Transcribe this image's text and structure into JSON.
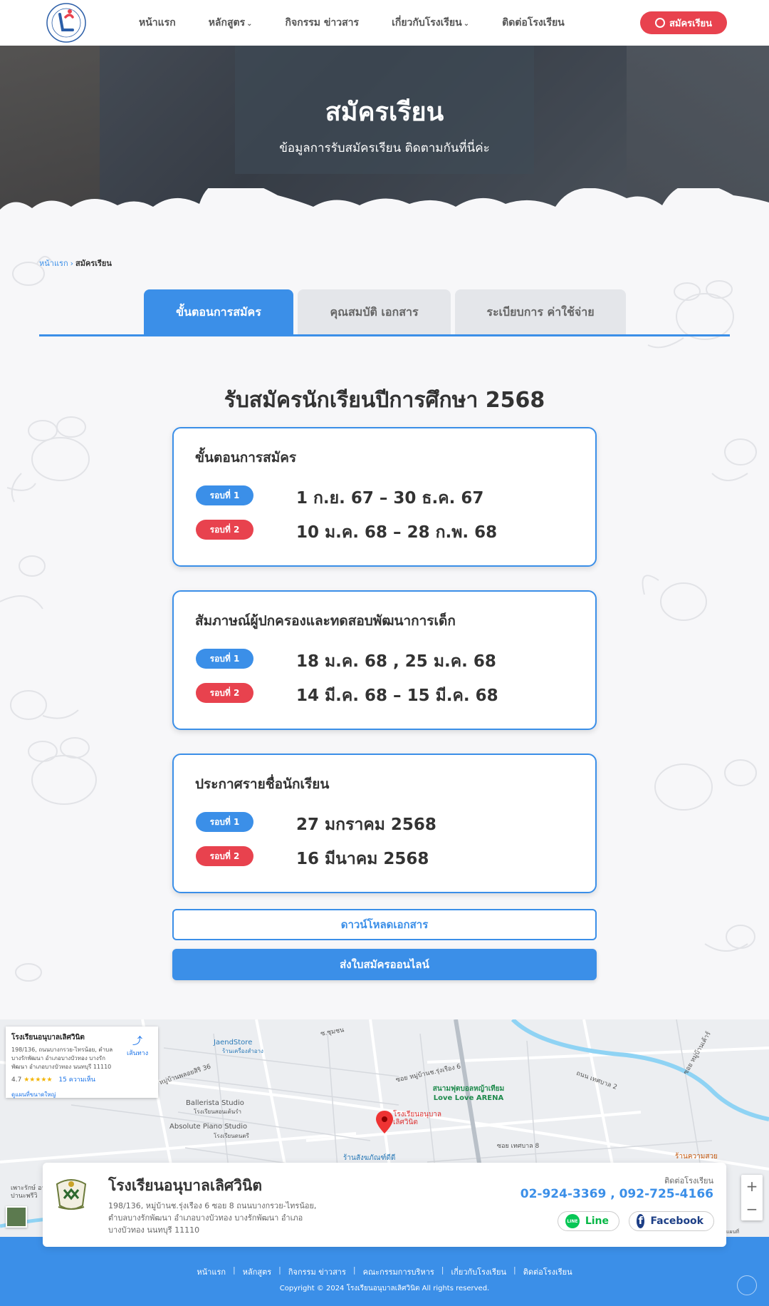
{
  "nav": {
    "links": [
      {
        "label": "หน้าแรก",
        "dropdown": false
      },
      {
        "label": "หลักสูตร",
        "dropdown": true
      },
      {
        "label": "กิจกรรม ข่าวสาร",
        "dropdown": false
      },
      {
        "label": "เกี่ยวกับโรงเรียน",
        "dropdown": true
      },
      {
        "label": "ติดต่อโรงเรียน",
        "dropdown": false
      }
    ],
    "apply_label": "สมัครเรียน"
  },
  "hero": {
    "title": "สมัครเรียน",
    "subtitle": "ข้อมูลการรับสมัครเรียน ติดตามกันที่นี่ค่ะ"
  },
  "breadcrumb": {
    "home": "หน้าแรก",
    "separator": "›",
    "current": "สมัครเรียน"
  },
  "tabs": [
    {
      "label": "ขั้นตอนการสมัคร",
      "active": true
    },
    {
      "label": "คุณสมบัติ เอกสาร",
      "active": false
    },
    {
      "label": "ระเบียบการ ค่าใช้จ่าย",
      "active": false
    }
  ],
  "section_title": "รับสมัครนักเรียนปีการศึกษา 2568",
  "cards": [
    {
      "title": "ขั้นตอนการสมัคร",
      "rounds": [
        {
          "badge": "รอบที่ 1",
          "date": "1 ก.ย. 67 – 30 ธ.ค. 67"
        },
        {
          "badge": "รอบที่ 2",
          "date": "10 ม.ค. 68 – 28 ก.พ. 68"
        }
      ]
    },
    {
      "title": "สัมภาษณ์ผู้ปกครองและทดสอบพัฒนาการเด็ก",
      "rounds": [
        {
          "badge": "รอบที่ 1",
          "date": "18 ม.ค. 68 , 25 ม.ค. 68"
        },
        {
          "badge": "รอบที่ 2",
          "date": "14 มี.ค. 68  – 15 มี.ค. 68"
        }
      ]
    },
    {
      "title": "ประกาศรายชื่อนักเรียน",
      "rounds": [
        {
          "badge": "รอบที่ 1",
          "date": "27 มกราคม 2568"
        },
        {
          "badge": "รอบที่ 2",
          "date": "16 มีนาคม 2568"
        }
      ]
    }
  ],
  "buttons": {
    "download": "ดาวน์โหลดเอกสาร",
    "submit": "ส่งใบสมัครออนไลน์"
  },
  "map": {
    "info": {
      "name": "โรงเรียนอนุบาลเลิศวินิต",
      "address": "198/136, ถนนบางกรวย-ไทรน้อย, ตำบลบางรักพัฒนา อำเภอบางบัวทอง บางรักพัฒนา อำเภอบางบัวทอง นนทบุรี 11110",
      "rating": "4.7",
      "stars": "★★★★★",
      "reviews": "15 ความเห็น",
      "larger_map": "ดูแผนที่ขนาดใหญ่",
      "directions": "เส้นทาง"
    },
    "labels": {
      "jaend": "JaendStore",
      "jaend_sub": "ร้านเครื่องสำอาง",
      "ballerista": "Ballerista Studio",
      "ballerista_sub": "โรงเรียนสอนเต้นรำ",
      "absolute": "Absolute Piano Studio",
      "absolute_sub": "โรงเรียนดนตรี",
      "arena": "สนามฟุตบอลหญ้าเทียม Love Love ARENA",
      "school_pin": "โรงเรียนอนุบาล เลิศวินิต",
      "shop": "ร้านสังฆภัณฑ์ดีดี",
      "soi1": "ซอย หมู่บ้านช.รุ่งเรือง 6",
      "soi2": "ซอย เทศบาล 8",
      "road1": "ถนน เทศบาล 2",
      "road2": "หมู่บ้านพลอยสิริ 36",
      "beauty": "ร้านความสวย",
      "village": "ซอย หมู่บ้านเค้าร์",
      "route": "ซ.ชุมชน",
      "edge": "เพาะรักษ์ อาปานะพรีวิ",
      "credit": "แผนที่"
    },
    "zoom_in": "+",
    "zoom_out": "−"
  },
  "contact": {
    "name": "โรงเรียนอนุบาลเลิศวินิต",
    "address": "198/136, หมู่บ้านช.รุ่งเรือง 6 ซอย 8 ถนนบางกรวย-ไทรน้อย, ตำบลบางรักพัฒนา อำเภอบางบัวทอง บางรักพัฒนา อำเภอบางบัวทอง นนทบุรี 11110",
    "label": "ติดต่อโรงเรียน",
    "phones": "02-924-3369 , 092-725-4166",
    "line_label": "Line",
    "line_icon_text": "LINE",
    "facebook_label": "Facebook",
    "facebook_icon_text": "f"
  },
  "footer": {
    "links": [
      "หน้าแรก",
      "หลักสูตร",
      "กิจกรรม ข่าวสาร",
      "คณะกรรมการบริหาร",
      "เกี่ยวกับโรงเรียน",
      "ติดต่อโรงเรียน"
    ],
    "separator": "|",
    "copyright": "Copyright © 2024 โรงเรียนอนุบาลเลิศวินิต All rights reserved."
  },
  "colors": {
    "primary": "#3b8fe8",
    "danger": "#e8424e",
    "text": "#333333"
  }
}
